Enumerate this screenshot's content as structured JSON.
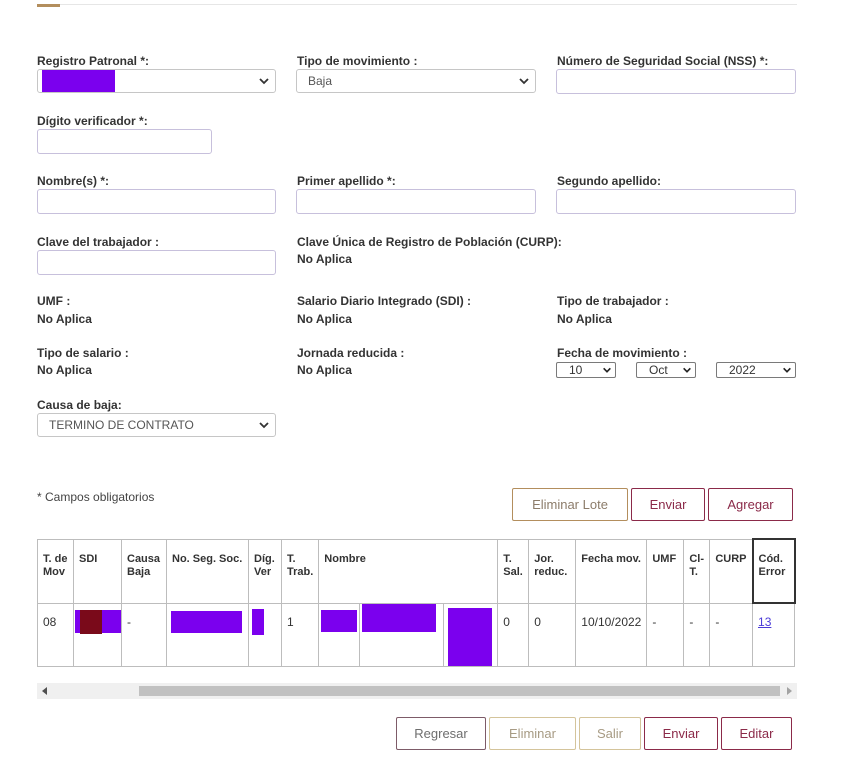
{
  "form": {
    "registro_patronal_label": "Registro Patronal *:",
    "tipo_movimiento_label": "Tipo de movimiento :",
    "tipo_movimiento_value": "Baja",
    "nss_label": "Número de Seguridad Social (NSS) *:",
    "digito_label": "Dígito verificador *:",
    "nombre_label": "Nombre(s) *:",
    "primer_apellido_label": "Primer apellido *:",
    "segundo_apellido_label": "Segundo apellido:",
    "clave_trabajador_label": "Clave del trabajador :",
    "curp_label": "Clave Única de Registro de Población (CURP):",
    "curp_value": "No Aplica",
    "umf_label": "UMF :",
    "umf_value": "No Aplica",
    "sdi_label": "Salario Diario Integrado (SDI) :",
    "sdi_value": "No Aplica",
    "tipo_trabajador_label": "Tipo de trabajador :",
    "tipo_trabajador_value": "No Aplica",
    "tipo_salario_label": "Tipo de salario :",
    "tipo_salario_value": "No Aplica",
    "jornada_label": "Jornada reducida :",
    "jornada_value": "No Aplica",
    "fecha_label": "Fecha de movimiento :",
    "fecha_day": "10",
    "fecha_month": "Oct",
    "fecha_year": "2022",
    "causa_label": "Causa de baja:",
    "causa_value": "TERMINO DE CONTRATO"
  },
  "note": "* Campos obligatorios",
  "lote_buttons": {
    "eliminar_lote": "Eliminar Lote",
    "enviar": "Enviar",
    "agregar": "Agregar"
  },
  "table": {
    "headers": [
      "T. de Mov",
      "SDI",
      "Causa Baja",
      "No. Seg. Soc.",
      "Díg. Ver",
      "T. Trab.",
      "Nombre",
      "T. Sal.",
      "Jor. reduc.",
      "Fecha mov.",
      "UMF",
      "Cl-T.",
      "CURP",
      "Cód. Error"
    ],
    "row": {
      "t_mov": "08",
      "causa": "-",
      "t_trab": "1",
      "t_sal": "0",
      "jor": "0",
      "fecha": "10/10/2022",
      "umf": "-",
      "clt": "-",
      "curp": "-",
      "cod_error": "13"
    }
  },
  "bottom_buttons": {
    "regresar": "Regresar",
    "eliminar": "Eliminar",
    "salir": "Salir",
    "enviar": "Enviar",
    "editar": "Editar"
  },
  "colors": {
    "accent_gold": "#b38e5d",
    "maroon": "#8b2a49",
    "redaction": "#7b00ee",
    "link": "#4a3ad8"
  }
}
